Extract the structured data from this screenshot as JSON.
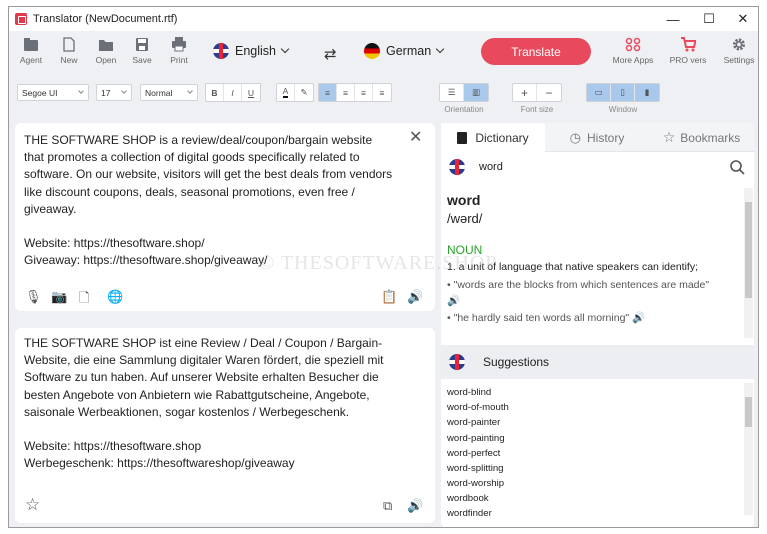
{
  "window": {
    "title": "Translator (NewDocument.rtf)"
  },
  "toolbar": {
    "agent": "Agent",
    "new": "New",
    "open": "Open",
    "save": "Save",
    "print": "Print",
    "source_lang": "English",
    "target_lang": "German",
    "translate": "Translate",
    "more_apps": "More Apps",
    "pro": "PRO vers",
    "settings": "Settings"
  },
  "format": {
    "font": "Segoe UI",
    "size": "17",
    "style": "Normal",
    "orientation_label": "Orientation",
    "font_size_label": "Font size",
    "window_label": "Window",
    "plus": "+",
    "minus": "−"
  },
  "source": {
    "text": "THE SOFTWARE SHOP is a review/deal/coupon/bargain website that promotes a collection of digital goods specifically related to software. On our website, visitors will get the best deals from vendors like discount coupons, deals, seasonal promotions, even free / giveaway.\n\nWebsite: https://thesoftware.shop/\nGiveaway: https://thesoftware.shop/giveaway/"
  },
  "target": {
    "text": "THE SOFTWARE SHOP ist eine Review / Deal / Coupon / Bargain-Website, die eine Sammlung digitaler Waren fördert, die speziell mit Software zu tun haben. Auf unserer Website erhalten Besucher die besten Angebote von Anbietern wie Rabattgutscheine, Angebote, saisonale Werbeaktionen, sogar kostenlos / Werbegeschenk.\n\nWebsite: https://thesoftware.shop\nWerbegeschenk: https://thesoftwareshop/giveaway"
  },
  "dictionary": {
    "tabs": [
      "Dictionary",
      "History",
      "Bookmarks"
    ],
    "query": "word",
    "headword": "word",
    "phonetic": "/wərd/",
    "pos": "NOUN",
    "definition": "1. a unit of language that native speakers can identify;",
    "example1": "• \"words are the blocks from which sentences are made\"",
    "example2": "• \"he hardly said ten words all morning\""
  },
  "suggestions": {
    "title": "Suggestions",
    "items": [
      "word-blind",
      "word-of-mouth",
      "word-painter",
      "word-painting",
      "word-perfect",
      "word-splitting",
      "word-worship",
      "wordbook",
      "wordfinder"
    ]
  },
  "watermark": "© THESOFTWARE.SHOP",
  "colors": {
    "accent": "#e8495c",
    "selected": "#a8c8ec",
    "pos": "#2aa32a"
  }
}
